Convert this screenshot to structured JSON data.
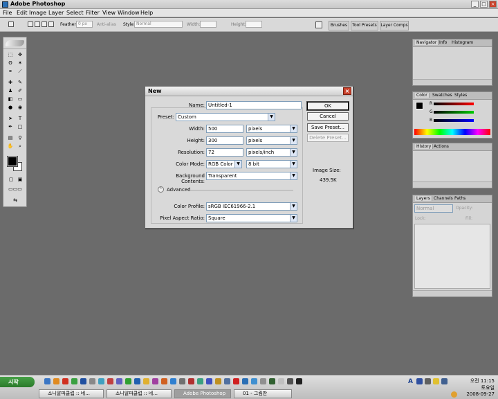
{
  "window": {
    "title": "Adobe Photoshop"
  },
  "menu": [
    "File",
    "Edit",
    "Image",
    "Layer",
    "Select",
    "Filter",
    "View",
    "Window",
    "Help"
  ],
  "options": {
    "feather_label": "Feather:",
    "feather_value": "0 px",
    "antialias_label": "Anti-alias",
    "style_label": "Style:",
    "style_value": "Normal",
    "width_label": "Width:",
    "height_label": "Height:"
  },
  "wells": [
    "Brushes",
    "Tool Presets",
    "Layer Comps"
  ],
  "panels": {
    "navigator": {
      "tabs": [
        "Navigator",
        "Info",
        "Histogram"
      ]
    },
    "color": {
      "tabs": [
        "Color",
        "Swatches",
        "Styles"
      ],
      "channels": [
        "R",
        "G",
        "B"
      ]
    },
    "history": {
      "tabs": [
        "History",
        "Actions"
      ]
    },
    "layers": {
      "tabs": [
        "Layers",
        "Channels",
        "Paths"
      ],
      "mode": "Normal",
      "opacity_label": "Opacity:",
      "lock_label": "Lock:",
      "fill_label": "Fill:"
    }
  },
  "dialog": {
    "title": "New",
    "name_label": "Name:",
    "name_value": "Untitled-1",
    "preset_label": "Preset:",
    "preset_value": "Custom",
    "width_label": "Width:",
    "width_value": "500",
    "width_unit": "pixels",
    "height_label": "Height:",
    "height_value": "300",
    "height_unit": "pixels",
    "resolution_label": "Resolution:",
    "resolution_value": "72",
    "resolution_unit": "pixels/inch",
    "colormode_label": "Color Mode:",
    "colormode_value": "RGB Color",
    "bitdepth_value": "8 bit",
    "background_label": "Background Contents:",
    "background_value": "Transparent",
    "advanced_label": "Advanced",
    "profile_label": "Color Profile:",
    "profile_value": "sRGB IEC61966-2.1",
    "aspect_label": "Pixel Aspect Ratio:",
    "aspect_value": "Square",
    "ok_label": "OK",
    "cancel_label": "Cancel",
    "save_preset_label": "Save Preset...",
    "delete_preset_label": "Delete Preset...",
    "image_size_label": "Image Size:",
    "image_size_value": "439.5K"
  },
  "taskbar": {
    "start_label": "시작",
    "buttons": [
      "소니알파클럽 :: 네...",
      "소니알파클럽 :: 네...",
      "Adobe Photoshop",
      "01 - 그림판"
    ],
    "clock_time": "오전 11:15",
    "clock_day": "토요일",
    "clock_date": "2008-09-27"
  },
  "colors": {
    "accent": "#2a7a2a",
    "close": "#c8402a"
  }
}
